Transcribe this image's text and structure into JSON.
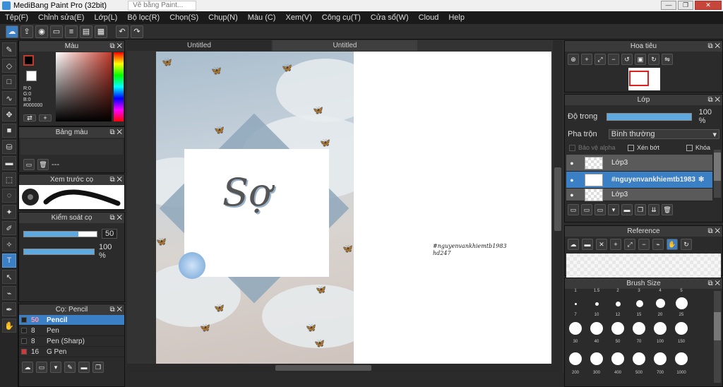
{
  "window": {
    "title": "MediBang Paint Pro (32bit)",
    "browser_tab": "Vẽ bằng Paint..."
  },
  "menu": [
    "Tệp(F)",
    "Chỉnh sửa(E)",
    "Lớp(L)",
    "Bộ lọc(R)",
    "Chọn(S)",
    "Chụp(N)",
    "Màu (C)",
    "Xem(V)",
    "Công cụ(T)",
    "Cửa sổ(W)",
    "Cloud",
    "Help"
  ],
  "toolbar_icons": [
    "cloud-upload-icon",
    "share-icon",
    "comment-icon",
    "page-icon",
    "list-icon",
    "panel-icon",
    "grid-icon",
    "undo-icon",
    "redo-icon"
  ],
  "color_panel": {
    "title": "Màu",
    "rgb": "R:0\nG:0\nB:0\n#000000",
    "fg_color": "#000000",
    "bg_color": "#ffffff"
  },
  "palette_panel": {
    "title": "Bảng màu",
    "empty": "---"
  },
  "brush_preview_panel": {
    "title": "Xem trước cọ"
  },
  "control_panel": {
    "title": "Kiểm soát cọ",
    "size": "50",
    "opacity": "100 %"
  },
  "brush_panel": {
    "title": "Cọ: Pencil",
    "items": [
      {
        "size": "50",
        "name": "Pencil",
        "selected": true
      },
      {
        "size": "8",
        "name": "Pen"
      },
      {
        "size": "8",
        "name": "Pen (Sharp)"
      },
      {
        "size": "16",
        "name": "G Pen"
      }
    ]
  },
  "canvas": {
    "tabs": [
      "Untitled",
      "Untitled"
    ],
    "art_text": "Sợ",
    "page_text": "#nguyenvankhiemtb1983\nhd247"
  },
  "navigator": {
    "title": "Hoa tiêu"
  },
  "layer_panel": {
    "title": "Lớp",
    "opacity_label": "Độ trong",
    "opacity_value": "100 %",
    "opacity": 1.0,
    "blend_label": "Pha trộn",
    "blend_value": "Bình thường",
    "alpha_lock": "Bảo vệ alpha",
    "clipping": "Xén bớt",
    "lock": "Khóa",
    "layers": [
      {
        "name": "Lớp3"
      },
      {
        "name": "#nguyenvankhiemtb1983",
        "selected": true
      },
      {
        "name": "Lớp3"
      }
    ]
  },
  "reference_panel": {
    "title": "Reference"
  },
  "brush_size_panel": {
    "title": "Brush Size",
    "row1": [
      "1",
      "1.5",
      "2",
      "3",
      "4",
      "5"
    ],
    "row2": [
      "7",
      "10",
      "12",
      "15",
      "20",
      "25"
    ],
    "row3": [
      "30",
      "40",
      "50",
      "70",
      "100",
      "150"
    ],
    "row4": [
      "200",
      "300",
      "400",
      "500",
      "700",
      "1000"
    ]
  },
  "colors": {
    "accent": "#3b7fc4",
    "foreground_red": "#c0392b"
  }
}
